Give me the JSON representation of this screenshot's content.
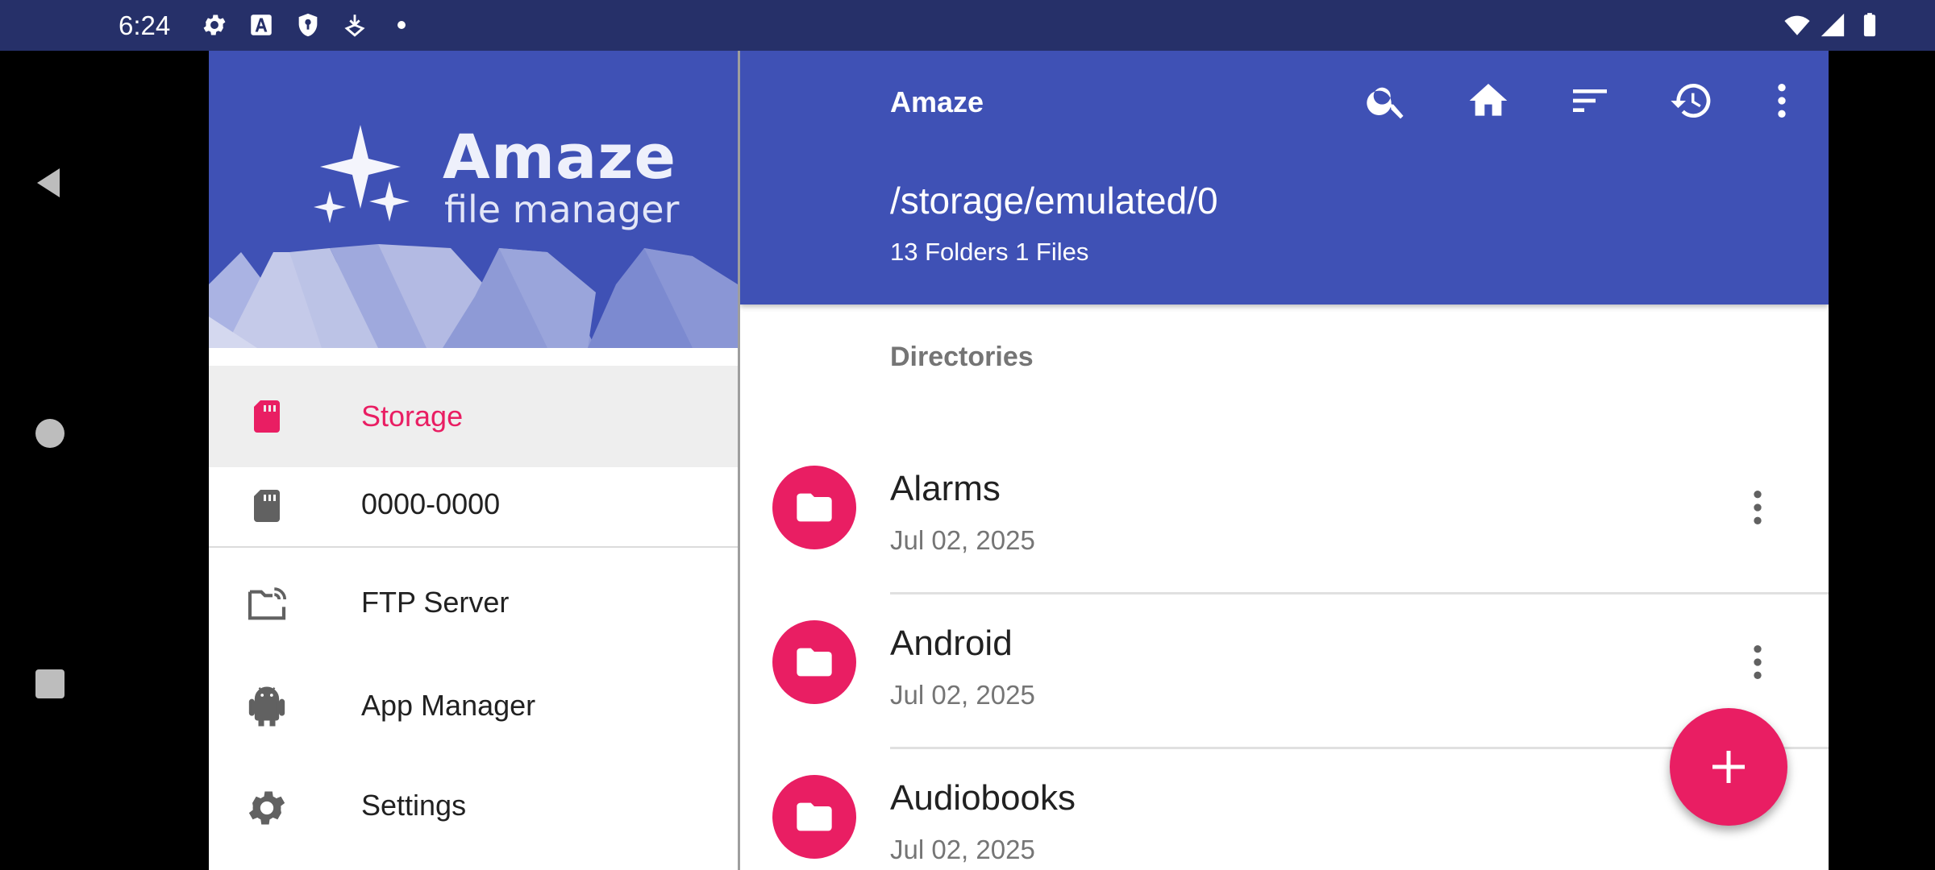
{
  "status_bar": {
    "time": "6:24",
    "icons": [
      "settings-icon",
      "font-a-icon",
      "shield-icon",
      "download-icon",
      "dot-icon",
      "wifi-icon",
      "signal-icon",
      "battery-icon"
    ]
  },
  "nav_bar": {
    "buttons": [
      "back-icon",
      "home-icon",
      "recents-icon"
    ]
  },
  "drawer": {
    "logo_title": "Amaze",
    "logo_subtitle": "file manager",
    "items": [
      {
        "label": "Storage",
        "icon": "sd-card-icon",
        "selected": true
      },
      {
        "label": "0000-0000",
        "icon": "sd-card-icon",
        "selected": false
      },
      {
        "label": "FTP Server",
        "icon": "ftp-folder-icon",
        "selected": false
      },
      {
        "label": "App Manager",
        "icon": "android-icon",
        "selected": false
      },
      {
        "label": "Settings",
        "icon": "gear-icon",
        "selected": false
      }
    ]
  },
  "toolbar": {
    "title": "Amaze",
    "actions": [
      "search-icon",
      "home-icon",
      "sort-icon",
      "history-icon",
      "more-vert-icon"
    ]
  },
  "location": {
    "path": "/storage/emulated/0",
    "summary": "13 Folders 1 Files"
  },
  "list": {
    "section_header": "Directories",
    "items": [
      {
        "name": "Alarms",
        "date": "Jul 02, 2025"
      },
      {
        "name": "Android",
        "date": "Jul 02, 2025"
      },
      {
        "name": "Audiobooks",
        "date": "Jul 02, 2025"
      }
    ]
  },
  "fab": {
    "icon": "plus-icon"
  },
  "colors": {
    "primary": "#3f51b5",
    "accent": "#e91e63",
    "status_bar": "#263069",
    "selected_bg": "#eeeeee"
  }
}
